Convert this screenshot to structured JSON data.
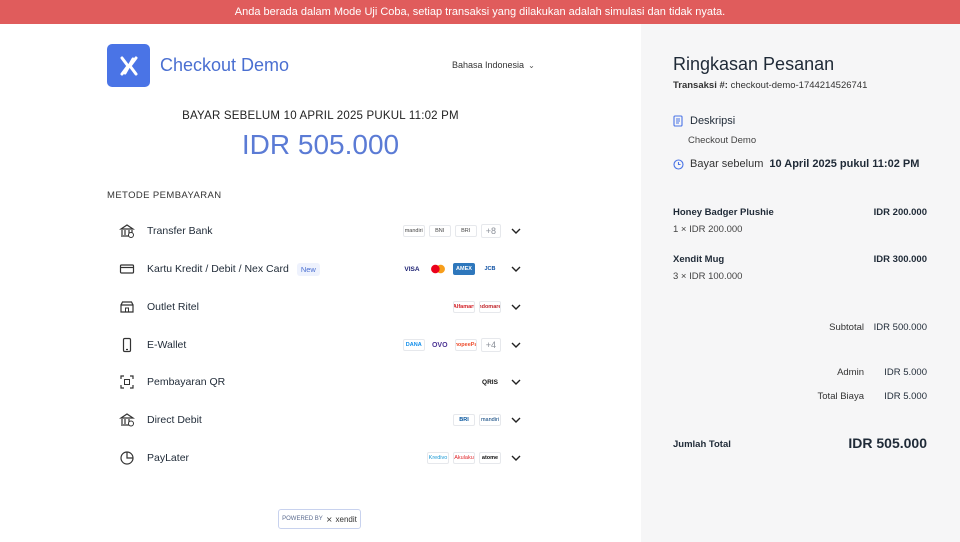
{
  "banner": "Anda berada dalam Mode Uji Coba, setiap transaksi yang dilakukan adalah simulasi dan tidak nyata.",
  "header": {
    "brand": "Checkout Demo",
    "language": "Bahasa Indonesia"
  },
  "payment": {
    "due": "BAYAR SEBELUM 10 APRIL 2025 PUKUL 11:02 PM",
    "amount": "IDR 505.000",
    "methods_title": "METODE PEMBAYARAN",
    "methods": [
      {
        "label": "Transfer Bank",
        "icon": "bank-icon",
        "logos": [
          "mandiri",
          "BNI",
          "BRI"
        ],
        "more": "+8"
      },
      {
        "label": "Kartu Kredit / Debit / Nex Card",
        "icon": "credit-card-icon",
        "badge": "New",
        "logos": [
          "VISA",
          "MC",
          "AMEX",
          "JCB"
        ]
      },
      {
        "label": "Outlet Ritel",
        "icon": "store-icon",
        "logos": [
          "Alfamart",
          "Indomaret"
        ]
      },
      {
        "label": "E-Wallet",
        "icon": "phone-icon",
        "logos": [
          "DANA",
          "OVO",
          "ShopeePay"
        ],
        "more": "+4"
      },
      {
        "label": "Pembayaran QR",
        "icon": "qr-icon",
        "logos": [
          "QRIS"
        ]
      },
      {
        "label": "Direct Debit",
        "icon": "bank-debit-icon",
        "logos": [
          "BRI",
          "mandiri"
        ]
      },
      {
        "label": "PayLater",
        "icon": "pie-icon",
        "logos": [
          "Kredivo",
          "Akulaku",
          "atome"
        ]
      }
    ],
    "powered_by": "POWERED BY",
    "powered_brand": "xendit"
  },
  "summary": {
    "title": "Ringkasan Pesanan",
    "txn_label": "Transaksi #:",
    "txn_id": "checkout-demo-1744214526741",
    "desc_label": "Deskripsi",
    "desc_value": "Checkout Demo",
    "pay_before_label": "Bayar sebelum",
    "pay_before_value": "10 April 2025 pukul 11:02 PM",
    "items": [
      {
        "name": "Honey Badger Plushie",
        "qty": "1 × IDR 200.000",
        "price": "IDR 200.000"
      },
      {
        "name": "Xendit Mug",
        "qty": "3 × IDR 100.000",
        "price": "IDR 300.000"
      }
    ],
    "subtotal_label": "Subtotal",
    "subtotal": "IDR 500.000",
    "admin_label": "Admin",
    "admin": "IDR 5.000",
    "fees_label": "Total Biaya",
    "fees": "IDR 5.000",
    "total_label": "Jumlah Total",
    "total": "IDR 505.000"
  },
  "colors": {
    "banner": "#e05c5c",
    "accent": "#4a74e6",
    "amount": "#5b7bd5",
    "panel": "#f6f6f7"
  }
}
